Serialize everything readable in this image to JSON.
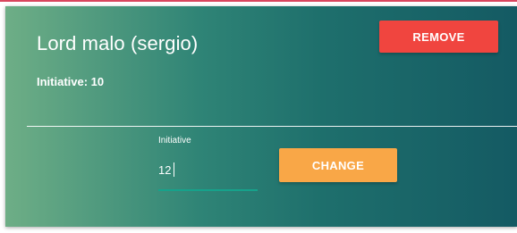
{
  "card": {
    "title": "Lord malo (sergio)",
    "initiative_text": "Initiative: 10",
    "remove_button_label": "REMOVE",
    "form": {
      "label": "Initiative",
      "value": "12",
      "change_button_label": "CHANGE"
    }
  },
  "colors": {
    "remove_button": "#f0453f",
    "change_button": "#f9a747",
    "input_underline": "#16a28b",
    "card_gradient_start": "#6eae86",
    "card_gradient_end": "#145a63"
  }
}
